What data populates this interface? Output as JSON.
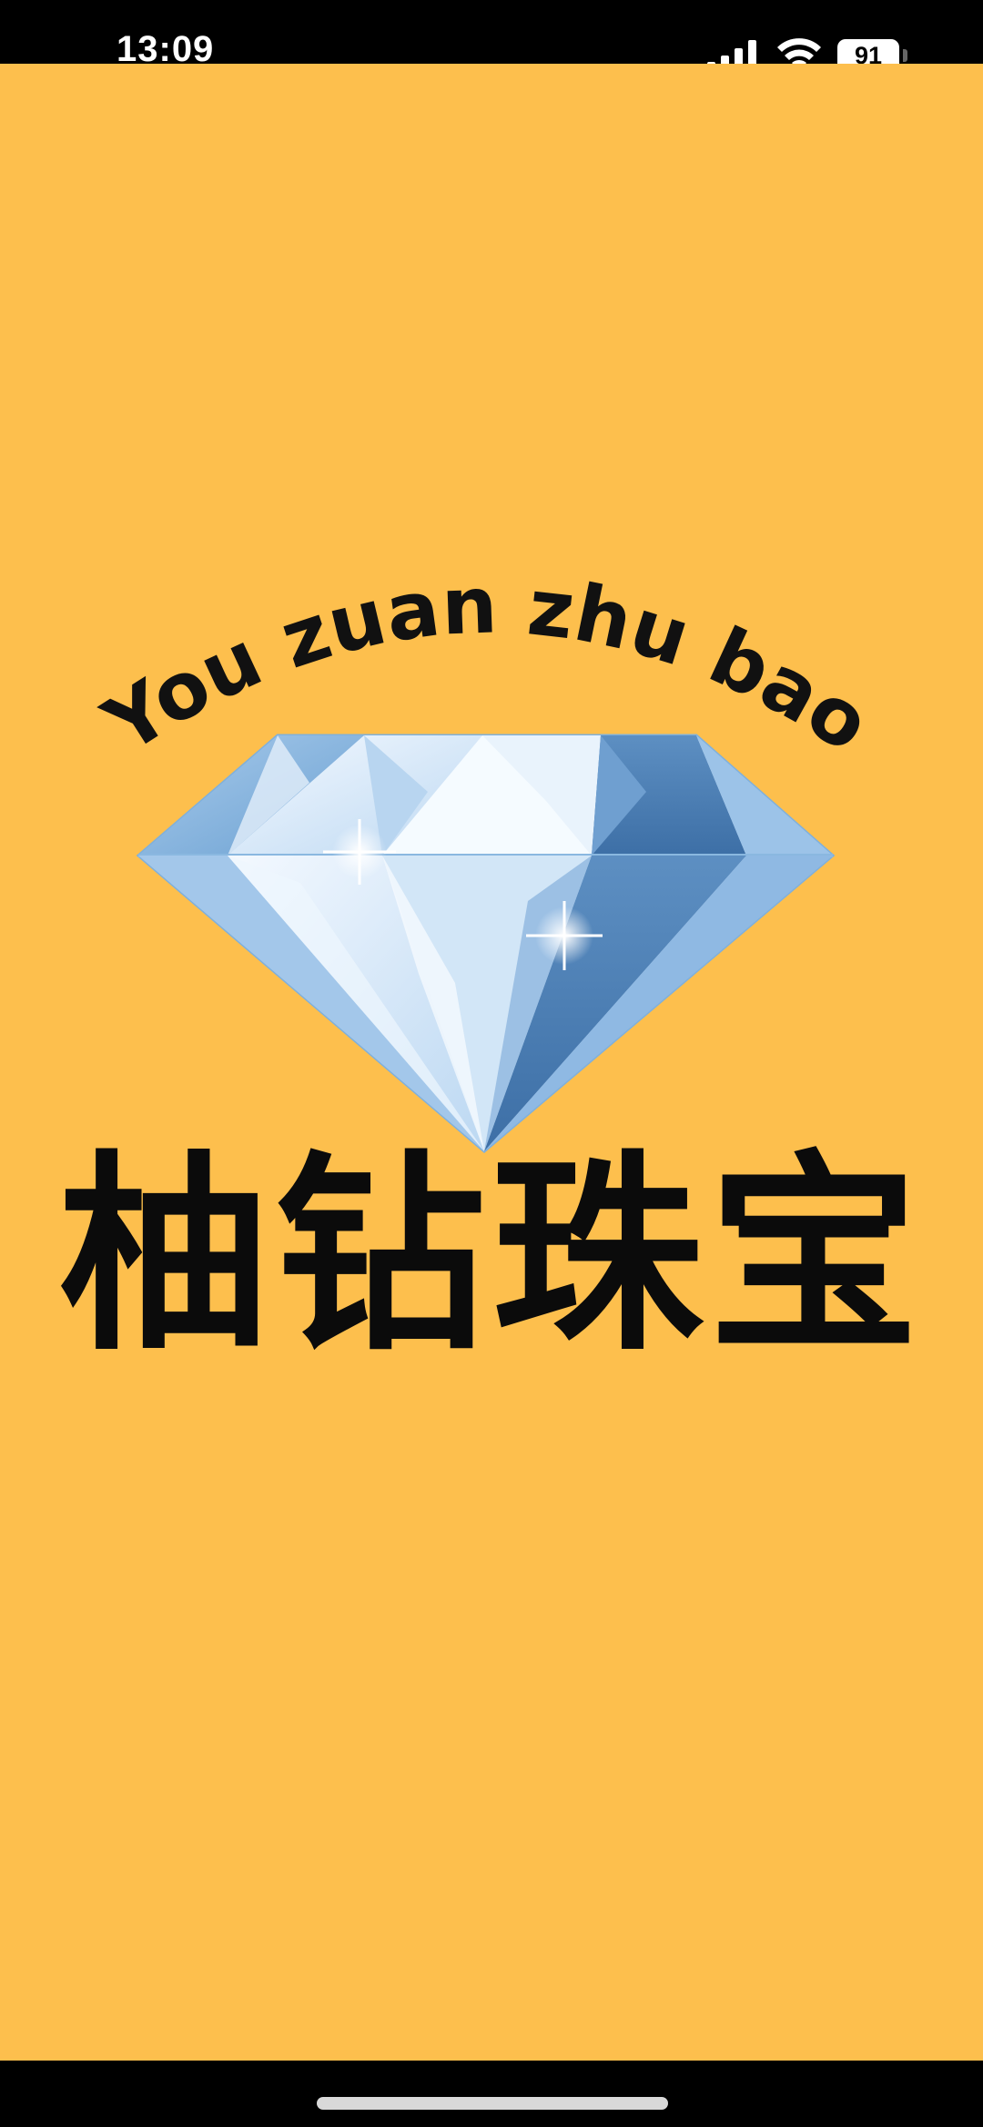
{
  "status_bar": {
    "time": "13:09",
    "battery_level": "91",
    "icons": [
      "signal-icon",
      "wifi-icon",
      "battery-icon"
    ]
  },
  "poster": {
    "background_color": "#fdbf4d",
    "arc_text": "You zuan zhu bao",
    "brand_name_cn": "柚钻珠宝",
    "graphic": "diamond-icon"
  }
}
